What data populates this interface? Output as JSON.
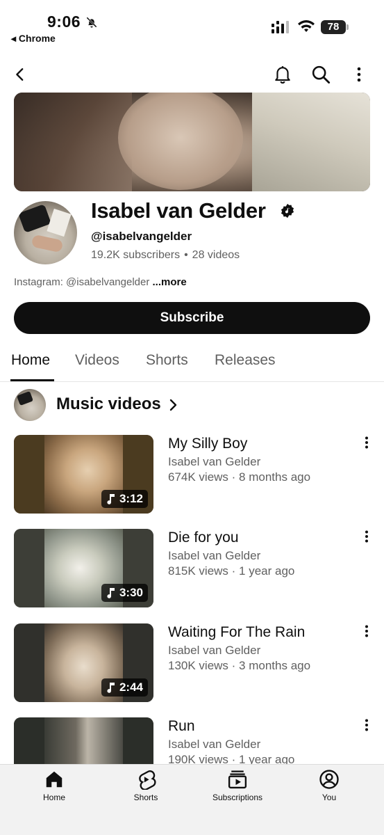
{
  "status_bar": {
    "time": "9:06",
    "back_app": "◂ Chrome",
    "battery": "78"
  },
  "channel": {
    "name": "Isabel van Gelder",
    "handle": "@isabelvangelder",
    "subscribers": "19.2K subscribers",
    "separator": "•",
    "videos_count": "28 videos",
    "description": "Instagram: @isabelvangelder",
    "more_label": "...more",
    "subscribe_label": "Subscribe"
  },
  "tabs": [
    {
      "label": "Home",
      "active": true
    },
    {
      "label": "Videos",
      "active": false
    },
    {
      "label": "Shorts",
      "active": false
    },
    {
      "label": "Releases",
      "active": false
    }
  ],
  "section": {
    "title": "Music videos"
  },
  "videos": [
    {
      "title": "My Silly Boy",
      "channel": "Isabel van Gelder",
      "meta": "674K views · 8 months ago",
      "duration": "3:12"
    },
    {
      "title": "Die for you",
      "channel": "Isabel van Gelder",
      "meta": "815K views · 1 year ago",
      "duration": "3:30"
    },
    {
      "title": "Waiting For The Rain",
      "channel": "Isabel van Gelder",
      "meta": "130K views · 3 months ago",
      "duration": "2:44"
    },
    {
      "title": "Run",
      "channel": "Isabel van Gelder",
      "meta": "190K views · 1 year ago",
      "duration": ""
    }
  ],
  "bottom_nav": {
    "home": "Home",
    "shorts": "Shorts",
    "subscriptions": "Subscriptions",
    "you": "You"
  },
  "icons": {
    "back": "back-arrow-icon",
    "notifications": "bell-icon",
    "search": "search-icon",
    "more": "more-vertical-icon",
    "verified": "music-note-verified-icon"
  },
  "colors": {
    "text_primary": "#0f0f0f",
    "text_secondary": "#606060",
    "subscribe_bg": "#0f0f0f",
    "nav_bg": "#f2f2f2"
  }
}
